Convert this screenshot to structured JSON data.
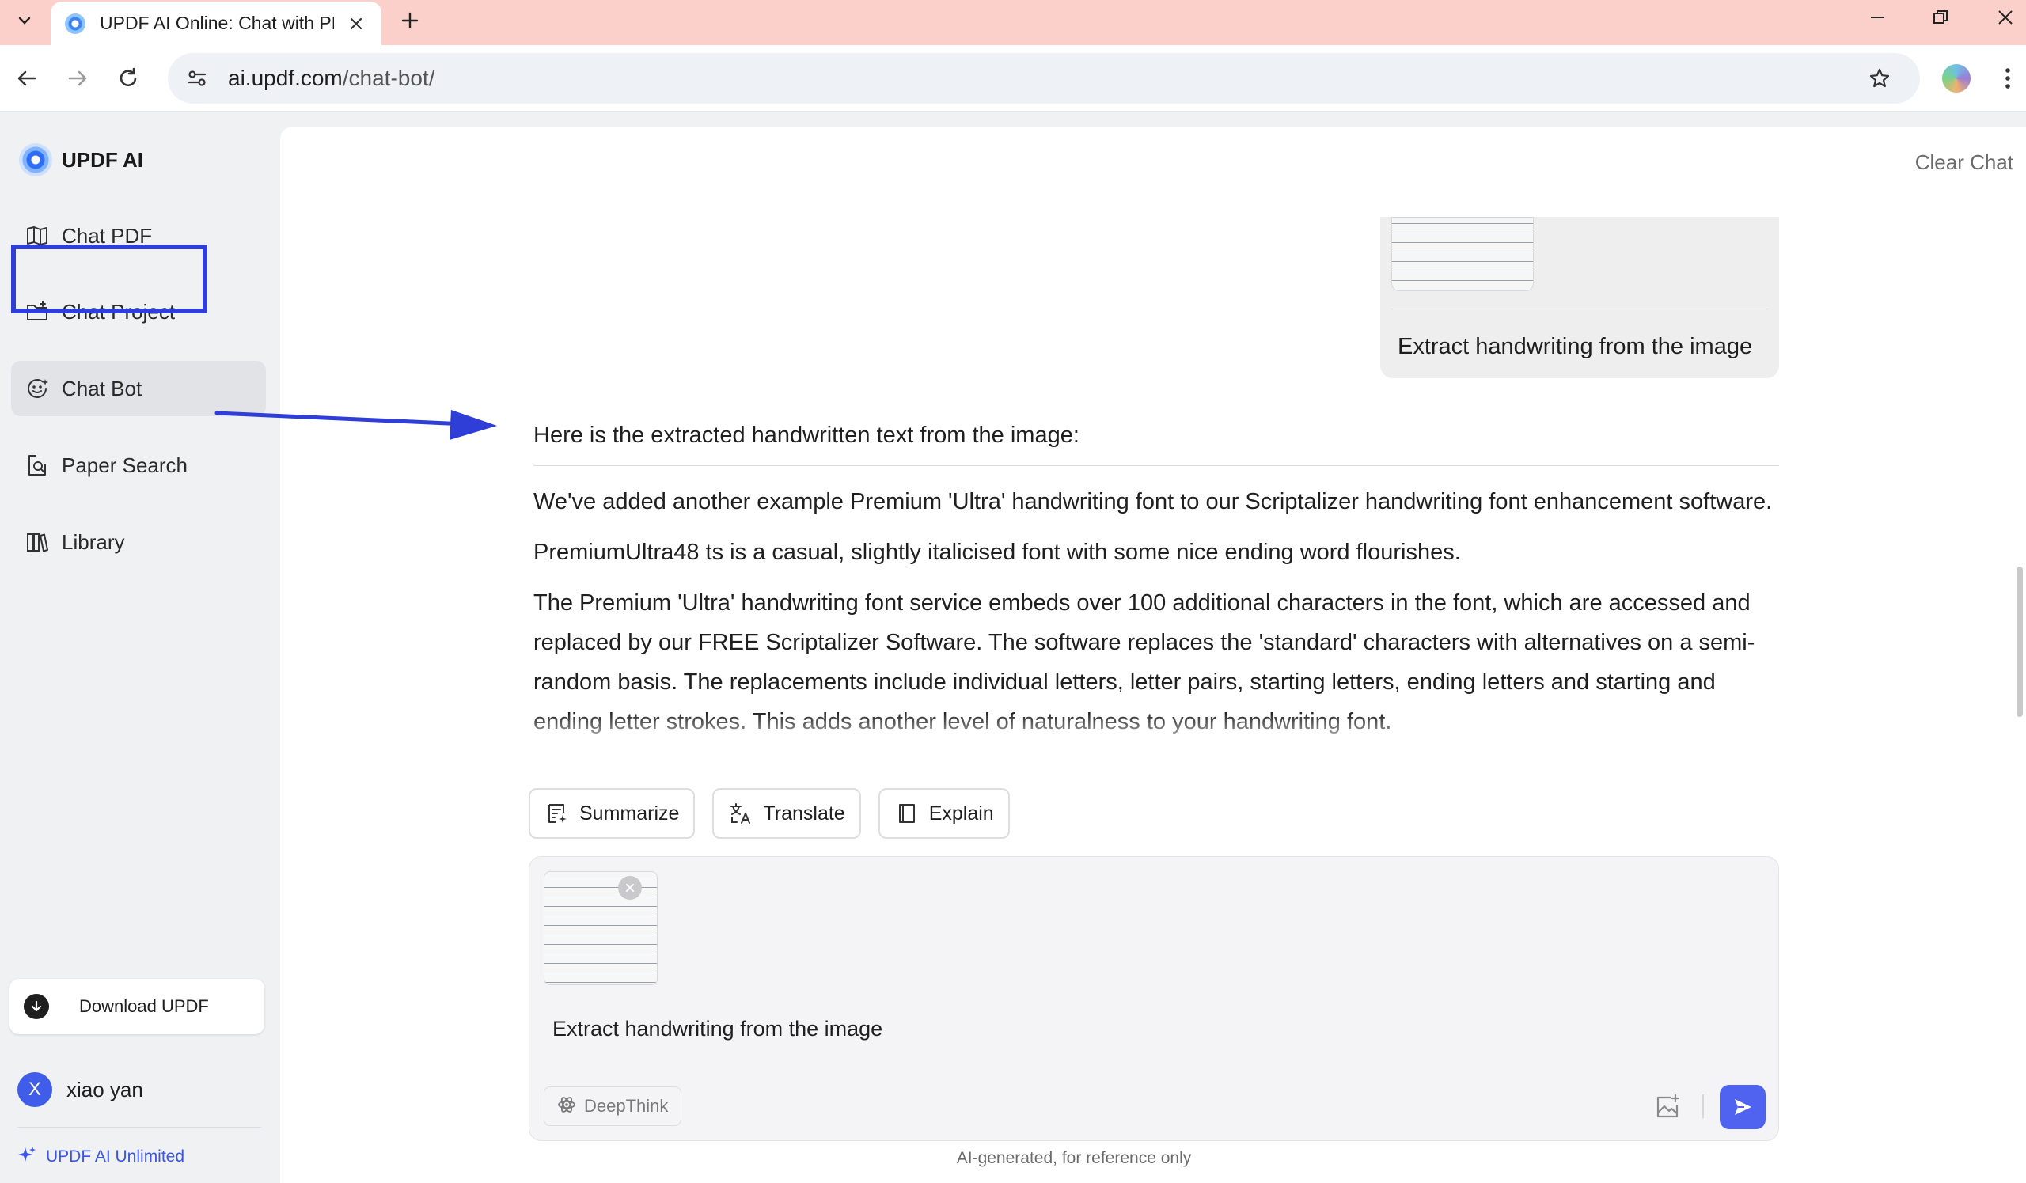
{
  "browser": {
    "tab_title": "UPDF AI Online: Chat with PDF",
    "url_host": "ai.updf.com",
    "url_path": "/chat-bot/"
  },
  "sidebar": {
    "brand": "UPDF AI",
    "items": [
      {
        "label": "Chat PDF",
        "icon": "book-open-icon"
      },
      {
        "label": "Chat Project",
        "icon": "folder-plus-icon"
      },
      {
        "label": "Chat Bot",
        "icon": "bot-icon"
      },
      {
        "label": "Paper Search",
        "icon": "search-doc-icon"
      },
      {
        "label": "Library",
        "icon": "library-icon"
      }
    ],
    "download_label": "Download UPDF",
    "user": {
      "initial": "X",
      "name": "xiao yan"
    },
    "plan_label": "UPDF AI Unlimited"
  },
  "main": {
    "clear_chat": "Clear Chat",
    "user_message": "Extract handwriting from the image",
    "reply": {
      "intro": "Here is the extracted handwritten text from the image:",
      "paragraphs": [
        "We've added another example Premium 'Ultra' handwriting font to our Scriptalizer handwriting font enhancement software.",
        "PremiumUltra48 ts is a casual, slightly italicised font with some nice ending word flourishes.",
        "The Premium 'Ultra' handwriting font service embeds over 100 additional characters in the font, which are accessed and replaced by our FREE Scriptalizer Software. The software replaces the 'standard' characters with alternatives on a semi-random basis. The replacements include individual letters, letter pairs, starting letters, ending letters and starting and ending letter strokes. This adds another level of naturalness to your handwriting font."
      ]
    },
    "quick_actions": [
      {
        "label": "Summarize",
        "icon": "summarize-icon"
      },
      {
        "label": "Translate",
        "icon": "translate-icon"
      },
      {
        "label": "Explain",
        "icon": "book-icon"
      }
    ],
    "composer": {
      "text": "Extract handwriting from the image",
      "deepthink_label": "DeepThink"
    },
    "footnote": "AI-generated, for reference only"
  },
  "colors": {
    "accent": "#4f63f0",
    "highlight": "#2f3ed6",
    "tabbar": "#fbd0cb"
  }
}
